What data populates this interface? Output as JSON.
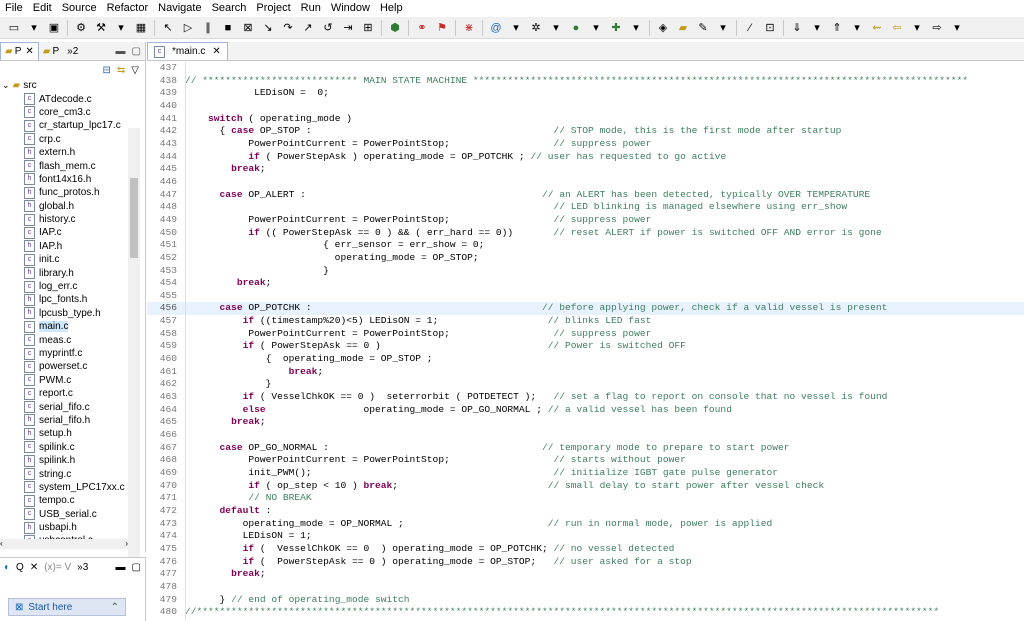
{
  "menu": [
    "File",
    "Edit",
    "Source",
    "Refactor",
    "Navigate",
    "Search",
    "Project",
    "Run",
    "Window",
    "Help"
  ],
  "left_panel": {
    "tabs": [
      {
        "label": "P"
      },
      {
        "label": "P"
      },
      {
        "label": "»2"
      }
    ],
    "root": "src",
    "files": [
      "ATdecode.c",
      "core_cm3.c",
      "cr_startup_lpc17.c",
      "crp.c",
      "extern.h",
      "flash_mem.c",
      "font14x16.h",
      "func_protos.h",
      "global.h",
      "history.c",
      "IAP.c",
      "IAP.h",
      "init.c",
      "library.h",
      "log_err.c",
      "lpc_fonts.h",
      "lpcusb_type.h",
      "main.c",
      "meas.c",
      "myprintf.c",
      "powerset.c",
      "PWM.c",
      "report.c",
      "serial_fifo.c",
      "serial_fifo.h",
      "setup.h",
      "spilink.c",
      "spilink.h",
      "string.c",
      "system_LPC17xx.c",
      "tempo.c",
      "USB_serial.c",
      "usbapi.h",
      "usbcontrol.c"
    ],
    "selected": "main.c"
  },
  "lower_panel": {
    "tabs": [
      "Q",
      "(x)= V",
      "»3"
    ],
    "start_here": "Start here"
  },
  "editor": {
    "tab_label": "*main.c",
    "lines": [
      {
        "n": "437",
        "t": ""
      },
      {
        "n": "438",
        "t": "// *************************** MAIN STATE MACHINE **************************************************************************************"
      },
      {
        "n": "439",
        "t": "            LEDisON =  0;"
      },
      {
        "n": "440",
        "t": ""
      },
      {
        "n": "441",
        "t": "    switch ( operating_mode )"
      },
      {
        "n": "442",
        "t": "      { case OP_STOP :                                          // STOP mode, this is the first mode after startup"
      },
      {
        "n": "443",
        "t": "           PowerPointCurrent = PowerPointStop;                  // suppress power"
      },
      {
        "n": "444",
        "t": "           if ( PowerStepAsk ) operating_mode = OP_POTCHK ; // user has requested to go active"
      },
      {
        "n": "445",
        "t": "        break;"
      },
      {
        "n": "446",
        "t": ""
      },
      {
        "n": "447",
        "t": "      case OP_ALERT :                                         // an ALERT has been detected, typically OVER TEMPERATURE"
      },
      {
        "n": "448",
        "t": "                                                                // LED blinking is managed elsewhere using err_show"
      },
      {
        "n": "449",
        "t": "           PowerPointCurrent = PowerPointStop;                  // suppress power"
      },
      {
        "n": "450",
        "t": "           if (( PowerStepAsk == 0 ) && ( err_hard == 0))       // reset ALERT if power is switched OFF AND error is gone"
      },
      {
        "n": "451",
        "t": "                        { err_sensor = err_show = 0;"
      },
      {
        "n": "452",
        "t": "                          operating_mode = OP_STOP;"
      },
      {
        "n": "453",
        "t": "                        }"
      },
      {
        "n": "454",
        "t": "         break;"
      },
      {
        "n": "455",
        "t": ""
      },
      {
        "n": "456",
        "t": "      case OP_POTCHK :                                        // before applying power, check if a valid vessel is present"
      },
      {
        "n": "457",
        "t": "          if ((timestamp%20)<5) LEDisON = 1;                   // blinks LED fast"
      },
      {
        "n": "458",
        "t": "           PowerPointCurrent = PowerPointStop;                  // suppress power"
      },
      {
        "n": "459",
        "t": "          if ( PowerStepAsk == 0 )                             // Power is switched OFF"
      },
      {
        "n": "460",
        "t": "              {  operating_mode = OP_STOP ;"
      },
      {
        "n": "461",
        "t": "                  break;"
      },
      {
        "n": "462",
        "t": "              }"
      },
      {
        "n": "463",
        "t": "          if ( VesselChkOK == 0 )  seterrorbit ( POTDETECT );   // set a flag to report on console that no vessel is found"
      },
      {
        "n": "464",
        "t": "          else                 operating_mode = OP_GO_NORMAL ; // a valid vessel has been found"
      },
      {
        "n": "465",
        "t": "        break;"
      },
      {
        "n": "466",
        "t": ""
      },
      {
        "n": "467",
        "t": "      case OP_GO_NORMAL :                                     // temporary mode to prepare to start power"
      },
      {
        "n": "468",
        "t": "           PowerPointCurrent = PowerPointStop;                  // starts without power"
      },
      {
        "n": "469",
        "t": "           init_PWM();                                          // initialize IGBT gate pulse generator"
      },
      {
        "n": "470",
        "t": "           if ( op_step < 10 ) break;                          // small delay to start power after vessel check"
      },
      {
        "n": "471",
        "t": "           // NO BREAK"
      },
      {
        "n": "472",
        "t": "      default :"
      },
      {
        "n": "473",
        "t": "          operating_mode = OP_NORMAL ;                         // run in normal mode, power is applied"
      },
      {
        "n": "474",
        "t": "          LEDisON = 1;"
      },
      {
        "n": "475",
        "t": "          if (  VesselChkOK == 0  ) operating_mode = OP_POTCHK; // no vessel detected"
      },
      {
        "n": "476",
        "t": "          if (  PowerStepAsk == 0 ) operating_mode = OP_STOP;   // user asked for a stop"
      },
      {
        "n": "477",
        "t": "        break;"
      },
      {
        "n": "478",
        "t": ""
      },
      {
        "n": "479",
        "t": "      } // end of operating_mode switch"
      },
      {
        "n": "480",
        "t": "//*********************************************************************************************************************************"
      }
    ],
    "highlight_line": "456"
  }
}
